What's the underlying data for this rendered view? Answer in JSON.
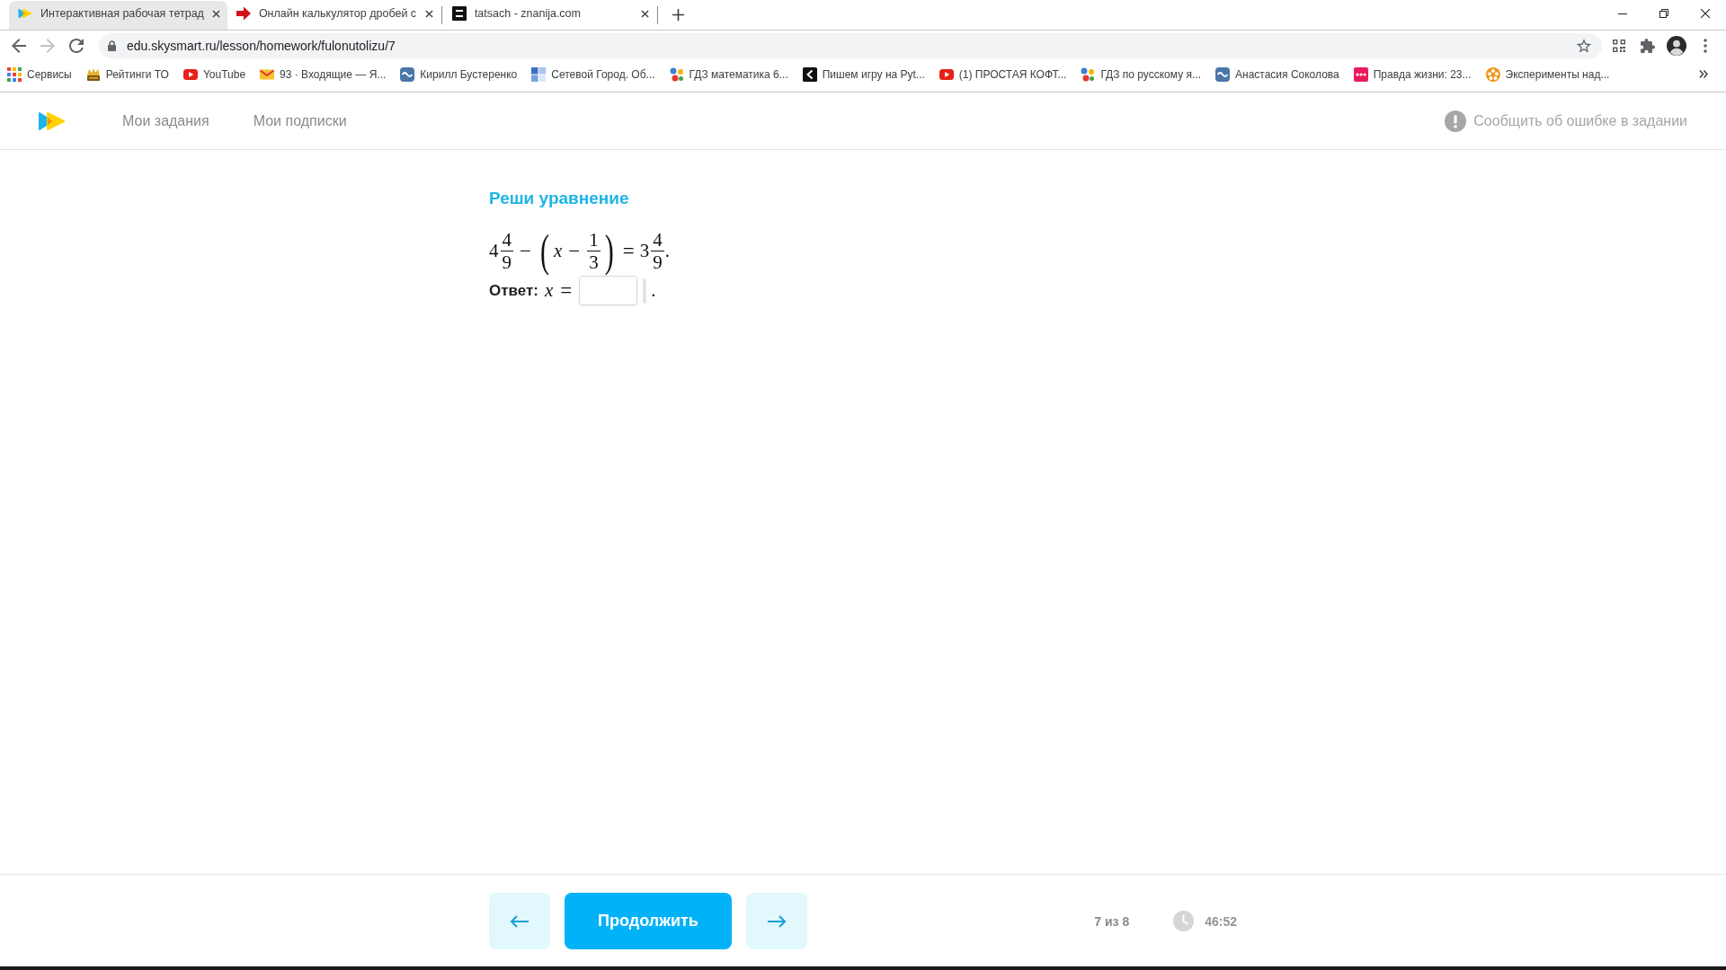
{
  "browser": {
    "tabs": [
      {
        "title": "Интерактивная рабочая тетрад",
        "kind": "arrows",
        "selected": true
      },
      {
        "title": "Онлайн калькулятор дробей с",
        "kind": "arrow",
        "selected": false
      },
      {
        "title": "tatsach - znanija.com",
        "kind": "darktile",
        "selected": false
      }
    ],
    "forward": {
      "disabled": true
    },
    "address": "edu.skysmart.ru/lesson/homework/fulonutolizu/7",
    "bookmarks": [
      {
        "label": "Сервисы",
        "kind": "grid"
      },
      {
        "label": "Рейтинги ТО",
        "kind": "stack"
      },
      {
        "label": "YouTube",
        "kind": "play"
      },
      {
        "label": "93 · Входящие — Я...",
        "kind": "envelope"
      },
      {
        "label": "Кирилл Бустеренко",
        "kind": "roundtile"
      },
      {
        "label": "Сетевой Город. Об...",
        "kind": "squares"
      },
      {
        "label": "ГДЗ математика 6...",
        "kind": "dots"
      },
      {
        "label": "Пишем игру на Pyt...",
        "kind": "darktile"
      },
      {
        "label": "(1) ПРОСТАЯ КОФТ...",
        "kind": "play"
      },
      {
        "label": "ГДЗ по русскому я...",
        "kind": "dots"
      },
      {
        "label": "Анастасия Соколова",
        "kind": "roundtile"
      },
      {
        "label": "Правда жизни: 23...",
        "kind": "striptile"
      },
      {
        "label": "Эксперименты над...",
        "kind": "reel"
      }
    ]
  },
  "header": {
    "nav": [
      {
        "label": "Мои задания"
      },
      {
        "label": "Мои подписки"
      }
    ],
    "report": "Сообщить об ошибке в задании"
  },
  "task": {
    "title": "Реши уравнение",
    "equation": [
      {
        "kind": "number",
        "text": "4"
      },
      {
        "kind": "fraction",
        "numerator": "4",
        "denominator": "9"
      },
      {
        "kind": "operator",
        "text": "−"
      },
      {
        "kind": "paren",
        "text": "("
      },
      {
        "kind": "variable",
        "text": "x"
      },
      {
        "kind": "operator",
        "text": "−"
      },
      {
        "kind": "fraction",
        "numerator": "1",
        "denominator": "3"
      },
      {
        "kind": "paren",
        "text": ")"
      },
      {
        "kind": "operator",
        "text": "="
      },
      {
        "kind": "number",
        "text": "3"
      },
      {
        "kind": "fraction",
        "numerator": "4",
        "denominator": "9"
      },
      {
        "kind": "punctuation",
        "text": "."
      }
    ],
    "answer": {
      "label": "Ответ:",
      "variable": "x",
      "relation": "=",
      "end": "."
    }
  },
  "footer": {
    "continue": "Продолжить",
    "progress": "7 из 8",
    "timer": "46:52"
  }
}
